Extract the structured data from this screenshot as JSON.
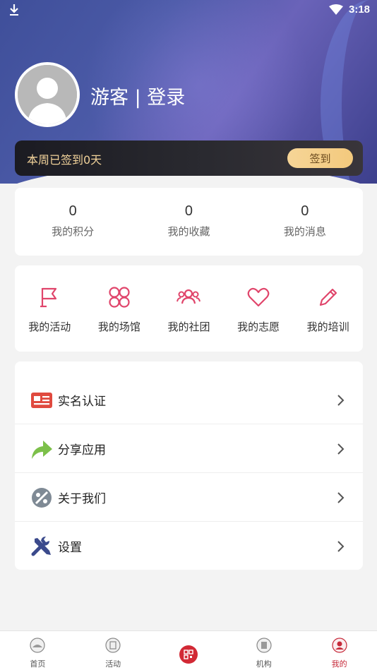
{
  "status_bar": {
    "time": "3:18",
    "icons": [
      "download-icon",
      "wifi-icon"
    ]
  },
  "profile": {
    "name_login": "游客 | 登录"
  },
  "signin": {
    "text": "本周已签到0天",
    "button": "签到"
  },
  "stats": [
    {
      "value": "0",
      "label": "我的积分"
    },
    {
      "value": "0",
      "label": "我的收藏"
    },
    {
      "value": "0",
      "label": "我的消息"
    }
  ],
  "shortcuts": [
    {
      "label": "我的活动",
      "icon": "flag-icon"
    },
    {
      "label": "我的场馆",
      "icon": "venue-icon"
    },
    {
      "label": "我的社团",
      "icon": "group-icon"
    },
    {
      "label": "我的志愿",
      "icon": "heart-icon"
    },
    {
      "label": "我的培训",
      "icon": "pencil-icon"
    }
  ],
  "menu": [
    {
      "label": "实名认证",
      "icon": "id-card-icon",
      "color": "#e04a3f"
    },
    {
      "label": "分享应用",
      "icon": "share-arrow-icon",
      "color": "#7cc04a"
    },
    {
      "label": "关于我们",
      "icon": "about-icon",
      "color": "#7f8a95"
    },
    {
      "label": "设置",
      "icon": "tools-icon",
      "color": "#3b4a8c"
    }
  ],
  "bottom_nav": [
    {
      "label": "首页",
      "icon": "home-icon"
    },
    {
      "label": "活动",
      "icon": "activity-icon"
    },
    {
      "label": "",
      "icon": "qr-code-icon"
    },
    {
      "label": "机构",
      "icon": "institution-icon"
    },
    {
      "label": "我的",
      "icon": "mine-icon",
      "active": true
    }
  ],
  "colors": {
    "accent": "#e0456b",
    "active_nav": "#c62a3a",
    "sign_text": "#f1d29a"
  }
}
